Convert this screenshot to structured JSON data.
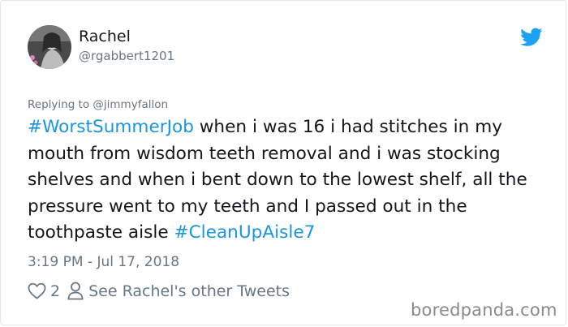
{
  "colors": {
    "accent": "#1b95e0",
    "text": "#14171a",
    "muted": "#657786",
    "border": "#e1e8ed",
    "watermark": "#8a8a8a"
  },
  "tweet": {
    "author_name": "Rachel",
    "author_handle": "@rgabbert1201",
    "reply_context": "Replying to @jimmyfallon",
    "hashtag_1": "#WorstSummerJob",
    "text_main": " when i was 16 i had stitches in my mouth from wisdom teeth removal and i was stocking shelves and when i bent down to the lowest shelf, all the pressure went to my teeth and I passed out in the toothpaste aisle ",
    "hashtag_2": "#CleanUpAisle7",
    "timestamp": "3:19 PM - Jul 17, 2018",
    "like_count": "2",
    "other_tweets_link": "See Rachel's other Tweets"
  },
  "icons": {
    "twitter": "twitter-bird-icon",
    "like": "heart-icon",
    "profile": "person-icon"
  },
  "watermark": "boredpanda.com"
}
